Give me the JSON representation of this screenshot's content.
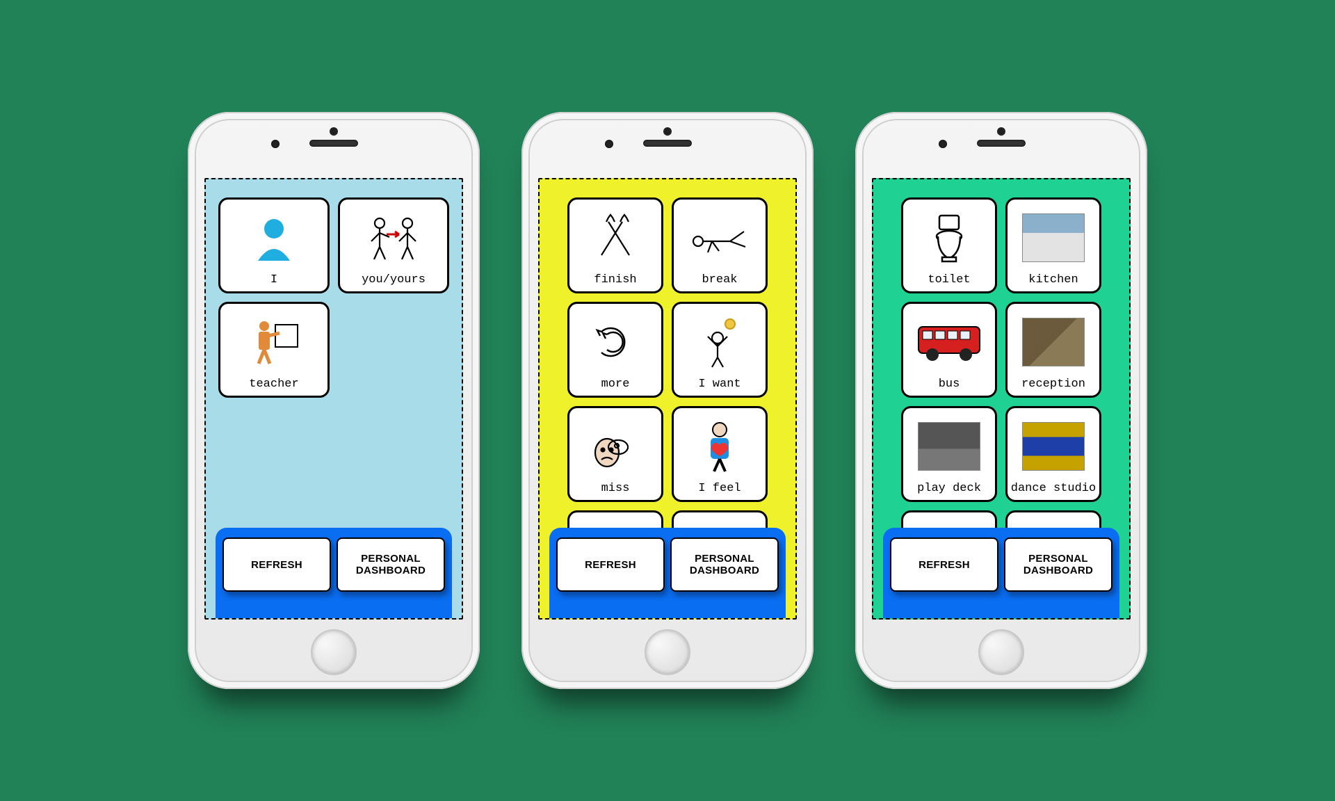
{
  "dock": {
    "refresh": "REFRESH",
    "dashboard": "PERSONAL\nDASHBOARD"
  },
  "phones": [
    {
      "theme": "blue",
      "cards": [
        {
          "id": "i",
          "label": "I",
          "icon": "person"
        },
        {
          "id": "you",
          "label": "you/yours",
          "icon": "two-people-arrow"
        },
        {
          "id": "teacher",
          "label": "teacher",
          "icon": "teacher"
        }
      ]
    },
    {
      "theme": "yellow",
      "cards": [
        {
          "id": "finish",
          "label": "finish",
          "icon": "crossed-hands"
        },
        {
          "id": "break",
          "label": "break",
          "icon": "lying"
        },
        {
          "id": "more",
          "label": "more",
          "icon": "swirl"
        },
        {
          "id": "iwant",
          "label": "I want",
          "icon": "idea"
        },
        {
          "id": "miss",
          "label": "miss",
          "icon": "sad-thought"
        },
        {
          "id": "ifeel",
          "label": "I feel",
          "icon": "heart-person"
        },
        {
          "id": "extra1",
          "label": "",
          "icon": "point"
        },
        {
          "id": "extra2",
          "label": "",
          "icon": "stick"
        }
      ]
    },
    {
      "theme": "green",
      "cards": [
        {
          "id": "toilet",
          "label": "toilet",
          "icon": "toilet"
        },
        {
          "id": "kitchen",
          "label": "kitchen",
          "icon": "photo-kitchen"
        },
        {
          "id": "bus",
          "label": "bus",
          "icon": "bus"
        },
        {
          "id": "reception",
          "label": "reception",
          "icon": "photo-reception"
        },
        {
          "id": "playdeck",
          "label": "play deck",
          "icon": "photo-deck"
        },
        {
          "id": "dance",
          "label": "dance studio",
          "icon": "photo-studio"
        },
        {
          "id": "extra3",
          "label": "",
          "icon": "photo"
        },
        {
          "id": "extra4",
          "label": "",
          "icon": "photo"
        }
      ]
    }
  ]
}
